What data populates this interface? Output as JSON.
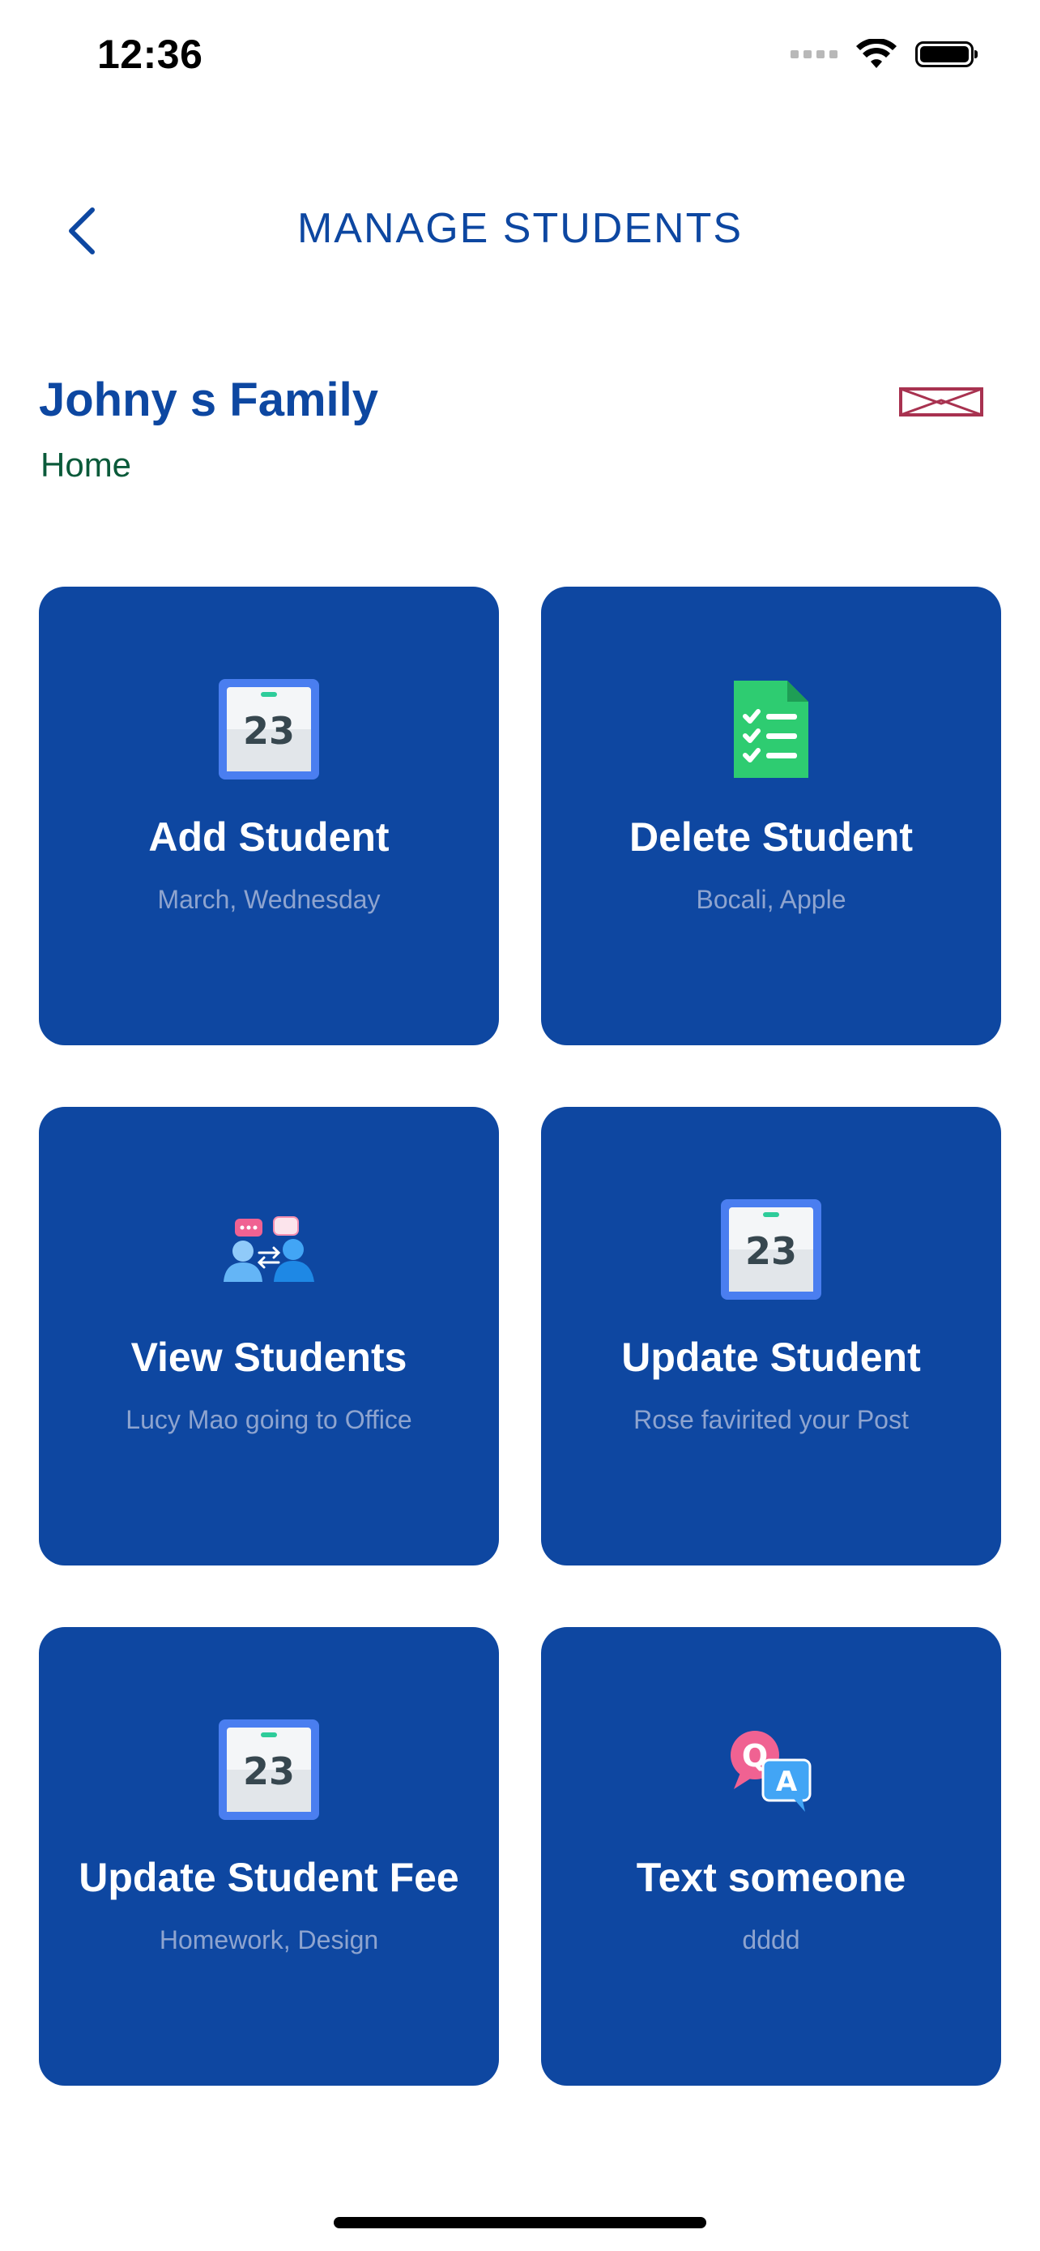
{
  "status_bar": {
    "time": "12:36",
    "icons": [
      "signal-icon",
      "wifi-icon",
      "battery-icon"
    ]
  },
  "header": {
    "back_icon": "chevron-left-icon",
    "title": "MANAGE STUDENTS"
  },
  "family": {
    "name": "Johny s Family",
    "subtitle": "Home",
    "image_icon": "broken-image-icon"
  },
  "cards": [
    {
      "title": "Add Student",
      "subtitle": "March, Wednesday",
      "icon": "calendar-icon"
    },
    {
      "title": "Delete Student",
      "subtitle": "Bocali, Apple",
      "icon": "checklist-document-icon"
    },
    {
      "title": "View Students",
      "subtitle": "Lucy Mao going to Office",
      "icon": "people-chat-icon"
    },
    {
      "title": "Update Student",
      "subtitle": "Rose favirited your Post",
      "icon": "calendar-icon"
    },
    {
      "title": "Update Student Fee",
      "subtitle": "Homework, Design",
      "icon": "calendar-icon"
    },
    {
      "title": "Text someone",
      "subtitle": "dddd",
      "icon": "qa-chat-icon"
    }
  ],
  "colors": {
    "primary": "#0e47a1",
    "title": "#0d47a1",
    "subtitle_green": "#0b5a3a",
    "card_sub": "#8ea4cf"
  }
}
